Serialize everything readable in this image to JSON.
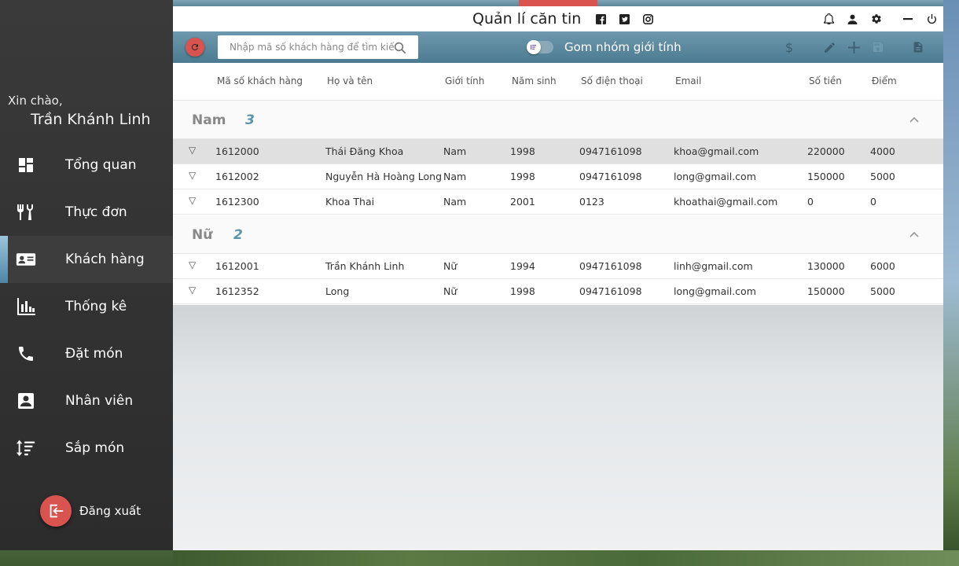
{
  "app": {
    "title": "Quản lí căn tin"
  },
  "sidebar": {
    "greeting": "Xin chào,",
    "username": "Trần Khánh Linh",
    "items": [
      {
        "label": "Tổng quan",
        "icon": "dashboard-icon"
      },
      {
        "label": "Thực đơn",
        "icon": "restaurant-icon"
      },
      {
        "label": "Khách hàng",
        "icon": "contact-card-icon",
        "active": true
      },
      {
        "label": "Thống kê",
        "icon": "bar-chart-icon"
      },
      {
        "label": "Đặt món",
        "icon": "phone-icon"
      },
      {
        "label": "Nhân viên",
        "icon": "badge-icon"
      },
      {
        "label": "Sắp món",
        "icon": "sort-icon"
      }
    ],
    "logout_label": "Đăng xuất"
  },
  "toolbar": {
    "search_placeholder": "Nhập mã số khách hàng để tìm kiếm",
    "group_toggle_label": "Gom nhóm giới tính"
  },
  "table": {
    "columns": [
      "Mã số khách hàng",
      "Họ và tên",
      "Giới tính",
      "Năm sinh",
      "Số điện thoại",
      "Email",
      "Số tiền",
      "Điểm"
    ],
    "groups": [
      {
        "name": "Nam",
        "count": "3",
        "rows": [
          [
            "1612000",
            "Thái Đăng Khoa",
            "Nam",
            "1998",
            "0947161098",
            "khoa@gmail.com",
            "220000",
            "4000"
          ],
          [
            "1612002",
            "Nguyễn Hà Hoàng Long",
            "Nam",
            "1998",
            "0947161098",
            "long@gmail.com",
            "150000",
            "5000"
          ],
          [
            "1612300",
            "Khoa Thai",
            "Nam",
            "2001",
            "0123",
            "khoathai@gmail.com",
            "0",
            "0"
          ]
        ]
      },
      {
        "name": "Nữ",
        "count": "2",
        "rows": [
          [
            "1612001",
            "Trần Khánh Linh",
            "Nữ",
            "1994",
            "0947161098",
            "linh@gmail.com",
            "130000",
            "6000"
          ],
          [
            "1612352",
            "Long",
            "Nữ",
            "1998",
            "0947161098",
            "long@gmail.com",
            "150000",
            "5000"
          ]
        ]
      }
    ]
  },
  "colors": {
    "accent": "#d9534f",
    "toolbar": "#5d8799",
    "sidebar": "#2f2f2f"
  }
}
